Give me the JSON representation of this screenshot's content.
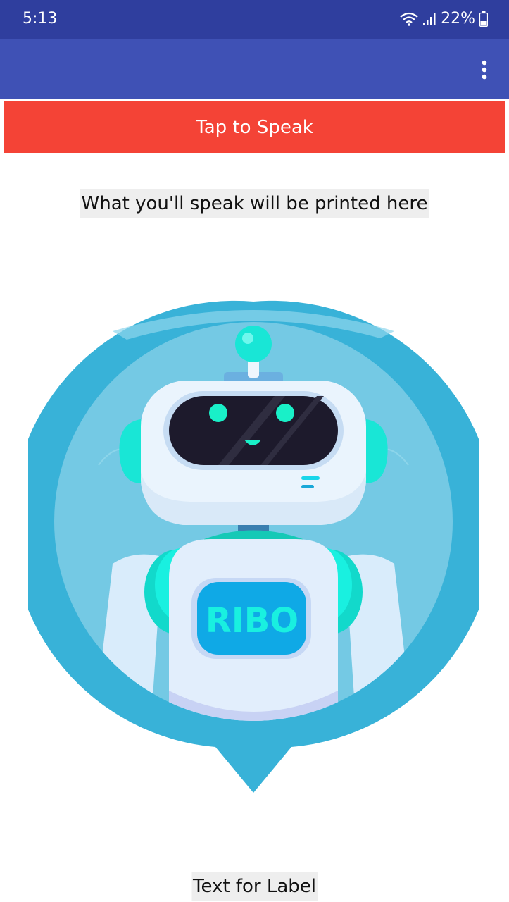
{
  "status_bar": {
    "time": "5:13",
    "battery": "22%",
    "icons": [
      "wifi-icon",
      "signal-icon",
      "battery-icon"
    ]
  },
  "app_bar": {
    "menu_icon": "more-vert-icon",
    "color": "#3f51b5"
  },
  "speak_button": {
    "label": "Tap to Speak",
    "color": "#f44336"
  },
  "speech_output": {
    "text": "What you'll speak will be printed here"
  },
  "robot": {
    "badge_text": "RIBO"
  },
  "bottom_label": {
    "text": "Text for Label"
  },
  "colors": {
    "status_bar": "#2f3e9e",
    "robot_ring": "#38b2d8",
    "robot_face": "#7ccbe5",
    "accent_cyan": "#19f0e0"
  }
}
